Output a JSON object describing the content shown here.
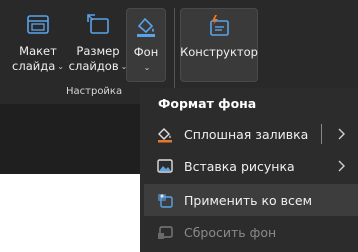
{
  "ribbon": {
    "layout_button": {
      "line1": "Макет",
      "line2": "слайда"
    },
    "size_button": {
      "line1": "Размер",
      "line2": "слайдов"
    },
    "background_button": {
      "label": "Фон"
    },
    "designer_button": {
      "label": "Конструктор"
    },
    "group_label": "Настройка",
    "caret": "⌄"
  },
  "menu": {
    "title": "Формат фона",
    "items": [
      {
        "label": "Сплошная заливка",
        "icon": "paint-bucket-icon",
        "has_submenu": true,
        "split": true,
        "state": "normal"
      },
      {
        "label": "Вставка рисунка",
        "icon": "picture-icon",
        "has_submenu": true,
        "split": false,
        "state": "normal"
      },
      {
        "label": "Применить ко всем",
        "icon": "apply-all-icon",
        "has_submenu": false,
        "split": false,
        "state": "hover"
      },
      {
        "label": "Сбросить фон",
        "icon": "reset-background-icon",
        "has_submenu": false,
        "split": false,
        "state": "disabled"
      }
    ]
  },
  "colors": {
    "ribbon_bg": "#292929",
    "menu_bg": "#2c2c2c",
    "hover_bg": "#3d3d3d",
    "accent_blue": "#5aa3e8",
    "accent_orange": "#e8792b"
  }
}
